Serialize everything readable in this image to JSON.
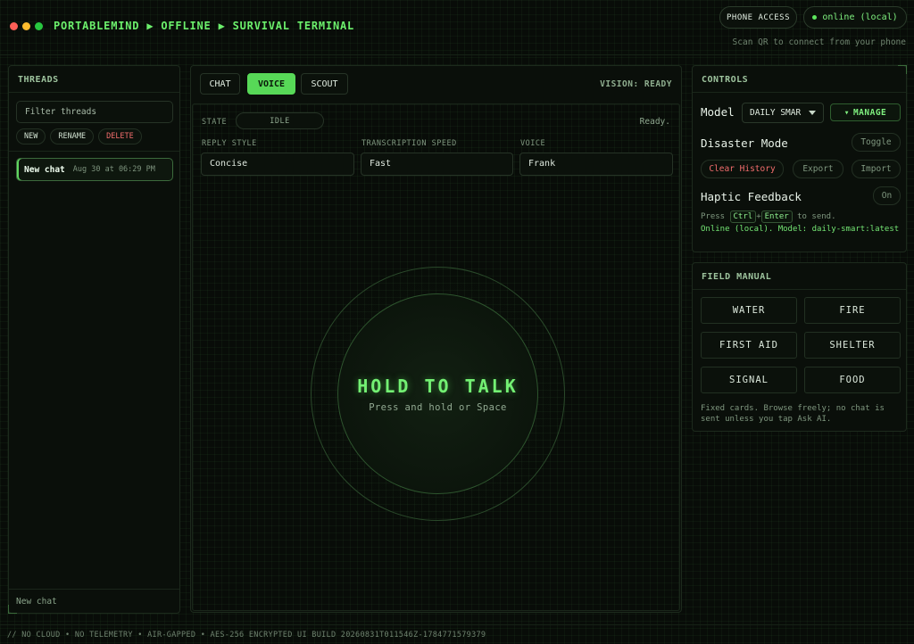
{
  "window": {
    "breadcrumb": "PORTABLEMIND ▶ OFFLINE ▶ SURVIVAL TERMINAL",
    "phone_access_label": "PHONE ACCESS",
    "connection_status": "online (local)",
    "scan_note": "Scan QR to connect from your phone"
  },
  "threads": {
    "header": "THREADS",
    "filter_placeholder": "Filter threads",
    "actions": {
      "new": "NEW",
      "rename": "RENAME",
      "delete": "DELETE"
    },
    "items": [
      {
        "name": "New chat",
        "time": "Aug 30 at 06:29 PM"
      }
    ],
    "current": "New chat"
  },
  "main": {
    "tabs": [
      {
        "label": "CHAT",
        "active": false
      },
      {
        "label": "VOICE",
        "active": true
      },
      {
        "label": "SCOUT",
        "active": false
      }
    ],
    "vision_status": "VISION: READY",
    "voice": {
      "state_label": "STATE",
      "state_value": "IDLE",
      "status": "Ready.",
      "reply_style": {
        "label": "REPLY STYLE",
        "value": "Concise"
      },
      "transcription_speed": {
        "label": "TRANSCRIPTION SPEED",
        "value": "Fast"
      },
      "voice": {
        "label": "VOICE",
        "value": "Frank"
      },
      "talk_title": "HOLD TO TALK",
      "talk_subtitle": "Press and hold or Space"
    }
  },
  "controls": {
    "header": "CONTROLS",
    "model_label": "Model",
    "model_value": "DAILY SMAR",
    "manage_label": "MANAGE",
    "disaster_mode_label": "Disaster Mode",
    "toggle_label": "Toggle",
    "clear_history_label": "Clear History",
    "export_label": "Export",
    "import_label": "Import",
    "haptic_label": "Haptic Feedback",
    "haptic_value": "On",
    "hint_prefix": "Press",
    "hint_key1": "Ctrl",
    "hint_plus": "+",
    "hint_key2": "Enter",
    "hint_suffix": "to send.",
    "status_line": "Online (local). Model: daily-smart:latest"
  },
  "field_manual": {
    "header": "FIELD MANUAL",
    "cards": [
      "WATER",
      "FIRE",
      "FIRST AID",
      "SHELTER",
      "SIGNAL",
      "FOOD"
    ],
    "note": "Fixed cards. Browse freely; no chat is sent unless you tap Ask AI."
  },
  "footer": {
    "text": "// NO CLOUD • NO TELEMETRY • AIR-GAPPED • AES-256 ENCRYPTED UI BUILD 20260831T011546Z-1784771579379"
  },
  "colors": {
    "accent": "#57d857",
    "danger": "#f26d6d",
    "background": "#070b07"
  },
  "icons": [
    "manage-caret-icon",
    "dropdown-caret-icon",
    "status-dot-icon"
  ]
}
